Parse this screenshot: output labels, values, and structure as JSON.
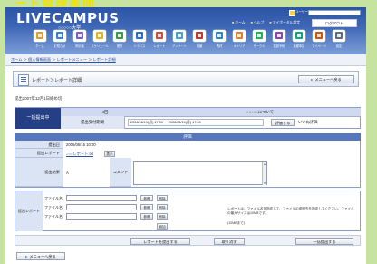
{
  "caption": "ート管理画面",
  "header": {
    "logo": "LIVECAMPUS",
    "university": "○○○○○大学",
    "user_label": "ユーザー名",
    "user_value": "",
    "links": [
      "ホーム",
      "ヘルプ",
      "マイポータル設定"
    ],
    "logout": "ログアウト"
  },
  "menu": [
    {
      "icon": "home-icon",
      "label": "ホーム",
      "color": "#e89a2c"
    },
    {
      "icon": "news-icon",
      "label": "お知らせ",
      "color": "#3d7fd0"
    },
    {
      "icon": "board-icon",
      "label": "掲示板",
      "color": "#7a5cc0"
    },
    {
      "icon": "schedule-icon",
      "label": "スケジュール",
      "color": "#e3b520"
    },
    {
      "icon": "class-icon",
      "label": "授業",
      "color": "#3a9a4a"
    },
    {
      "icon": "syllabus-icon",
      "label": "シラバス",
      "color": "#2f6ec4"
    },
    {
      "icon": "report-icon",
      "label": "レポート",
      "color": "#d44a3a"
    },
    {
      "icon": "survey-icon",
      "label": "アンケート",
      "color": "#4aa0c8"
    },
    {
      "icon": "grades-icon",
      "label": "成績",
      "color": "#c0392b"
    },
    {
      "icon": "materials-icon",
      "label": "教材",
      "color": "#2e86c1"
    },
    {
      "icon": "career-icon",
      "label": "キャリア",
      "color": "#e67e22"
    },
    {
      "icon": "circle-icon",
      "label": "サークル",
      "color": "#27ae60"
    },
    {
      "icon": "facility-icon",
      "label": "施設予約",
      "color": "#8e44ad"
    },
    {
      "icon": "application-icon",
      "label": "各種申請",
      "color": "#16a085"
    },
    {
      "icon": "mypage-icon",
      "label": "マイページ",
      "color": "#d35400"
    },
    {
      "icon": "settings-icon",
      "label": "設定",
      "color": "#5d6d7e"
    }
  ],
  "breadcrumb": "ホーム ＞ 個人情報画面 ＞ レポートメニュー ＞ レポート詳細",
  "title": "レポート＞レポート詳細",
  "back_button": "メニューへ戻る",
  "deadline_note": "提出2007年12月1日締め切",
  "summary": {
    "status": "一括提出中",
    "round": "4回",
    "topic": "○○○○○について",
    "period_label": "提出受付期間",
    "period": "2006/06/19(月) 17:00 ～ 2006/06/19(月) 17:00",
    "evaluate_button": "評価する",
    "evaluate_text": "いいね評価"
  },
  "evaluation": {
    "heading": "評価",
    "submitted_label": "提出日",
    "submitted": "2006/06/15 10:00",
    "report_label": "提出レポート",
    "report_file": "○○○レポート.txt",
    "report_button": "表示",
    "result_label": "提出結果",
    "result": "A",
    "comment_label": "コメント",
    "comment": ""
  },
  "upload": {
    "label": "提出レポート",
    "rows": [
      {
        "label": "ファイル名",
        "value": "",
        "browse": "参照",
        "remove": "削除"
      },
      {
        "label": "ファイル名",
        "value": "",
        "browse": "参照",
        "remove": "削除"
      },
      {
        "label": "ファイル名",
        "value": "",
        "browse": "参照",
        "remove": "削除"
      }
    ],
    "add": "追加",
    "note": "レポートは、ファイル名を指定して、ファイルの参照先を指定してください。ファイルの最大サイズは10MBです。",
    "limit": "(10MBまで)"
  },
  "actions": {
    "submit": "レポートを提出する",
    "cancel": "取り消す",
    "bulk": "一括提出する"
  },
  "footer_back": "メニューへ戻る",
  "colors": {
    "header": "#3d66b6",
    "section": "#5677bd",
    "status_cell": "#243f84",
    "label_cell": "#dbe4f4",
    "outer": "#c6e4a0",
    "caption": "#f3e100"
  }
}
